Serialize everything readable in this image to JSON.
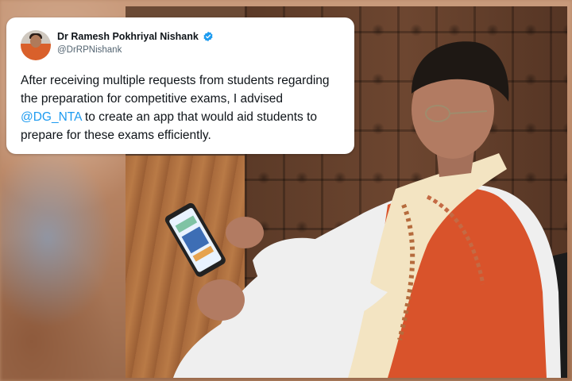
{
  "tweet": {
    "author_name": "Dr Ramesh Pokhriyal Nishank",
    "handle": "@DrRPNishank",
    "text_before": "After receiving multiple requests from students regarding the preparation for competitive exams, I advised ",
    "mention": "@DG_NTA",
    "text_after": " to create an app that would aid students to prepare for these exams efficiently.",
    "verified_icon": "verified-badge-icon",
    "verified_color": "#1d9bf0"
  },
  "colors": {
    "mention": "#1d9bf0",
    "card_bg": "#ffffff",
    "text": "#0f1419",
    "handle": "#536471"
  }
}
